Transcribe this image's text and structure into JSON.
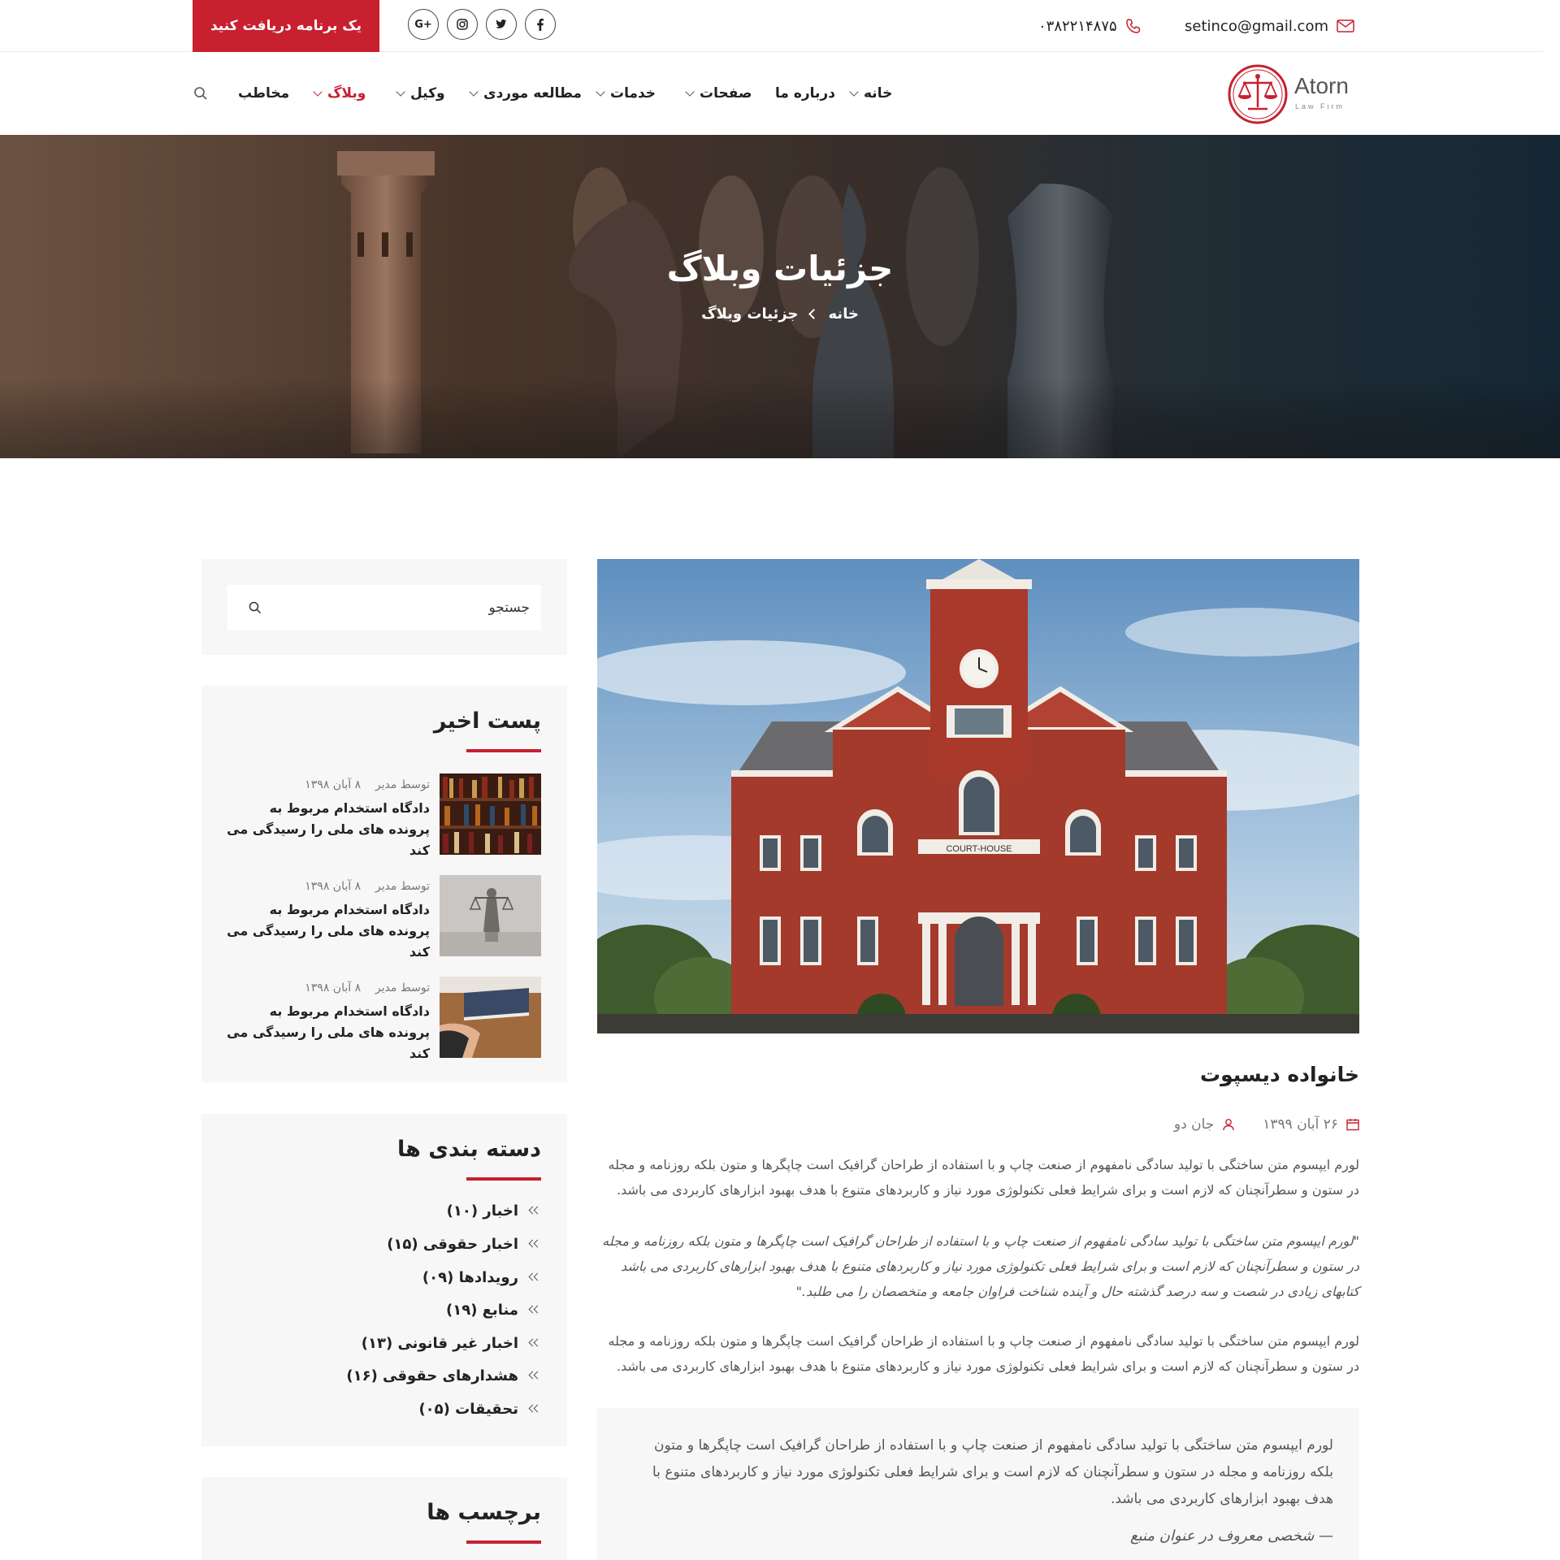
{
  "topbar": {
    "email": "setinco@gmail.com",
    "phone": "۰۳۸۲۲۱۴۸۷۵",
    "cta_label": "یک برنامه دریافت کنید",
    "social": [
      "facebook-icon",
      "twitter-icon",
      "instagram-icon",
      "google-plus-icon"
    ],
    "google_plus_label": "G+"
  },
  "logo": {
    "name": "Atorn",
    "sub": "Law Firm"
  },
  "nav": {
    "items": [
      {
        "label": "خانه",
        "dropdown": true
      },
      {
        "label": "درباره ما",
        "dropdown": false
      },
      {
        "label": "صفحات",
        "dropdown": true
      },
      {
        "label": "خدمات",
        "dropdown": true
      },
      {
        "label": "مطالعه موردی",
        "dropdown": true
      },
      {
        "label": "وکیل",
        "dropdown": true
      },
      {
        "label": "وبلاگ",
        "dropdown": true,
        "active": true
      },
      {
        "label": "مخاطب",
        "dropdown": false
      }
    ]
  },
  "hero": {
    "title": "جزئیات وبلاگ",
    "crumb_home": "خانه",
    "crumb_current": "جزئیات وبلاگ"
  },
  "sidebar": {
    "search_placeholder": "جستجو",
    "recent_title": "پست اخیر",
    "recent_posts": [
      {
        "author": "توسط مدیر",
        "date": "۸ آبان ۱۳۹۸",
        "title": "دادگاه استخدام مربوط به پرونده های ملی را رسیدگی می کند"
      },
      {
        "author": "توسط مدیر",
        "date": "۸ آبان ۱۳۹۸",
        "title": "دادگاه استخدام مربوط به پرونده های ملی را رسیدگی می کند"
      },
      {
        "author": "توسط مدیر",
        "date": "۸ آبان ۱۳۹۸",
        "title": "دادگاه استخدام مربوط به پرونده های ملی را رسیدگی می کند"
      }
    ],
    "categories_title": "دسته بندی ها",
    "categories": [
      "اخبار (۱۰)",
      "اخبار حقوقی (۱۵)",
      "رویدادها (۰۹)",
      "منابع (۱۹)",
      "اخبار غیر قانونی (۱۳)",
      "هشدارهای حقوقی (۱۶)",
      "تحقیقات (۰۵)"
    ],
    "tags_title": "برچسب ها"
  },
  "post": {
    "image_caption": "COURT-HOUSE",
    "heading": "خانواده دیسپوت",
    "date": "۲۶ آبان ۱۳۹۹",
    "author": "جان دو",
    "p1": "لورم ایپسوم متن ساختگی با تولید سادگی نامفهوم از صنعت چاپ و با استفاده از طراحان گرافیک است چاپگرها و متون بلکه روزنامه و مجله در ستون و سطرآنچنان که لازم است و برای شرایط فعلی تکنولوژی مورد نیاز و کاربردهای متنوع با هدف بهبود ابزارهای کاربردی می باشد.",
    "p2": "\"لورم ایپسوم متن ساختگی با تولید سادگی نامفهوم از صنعت چاپ و با استفاده از طراحان گرافیک است چاپگرها و متون بلکه روزنامه و مجله در ستون و سطرآنچنان که لازم است و برای شرایط فعلی تکنولوژی مورد نیاز و کاربردهای متنوع با هدف بهبود ابزارهای کاربردی می باشد کتابهای زیادی در شصت و سه درصد گذشته حال و آینده شناخت فراوان جامعه و متخصصان را می طلبد.\"",
    "p3": "لورم ایپسوم متن ساختگی با تولید سادگی نامفهوم از صنعت چاپ و با استفاده از طراحان گرافیک است چاپگرها و متون بلکه روزنامه و مجله در ستون و سطرآنچنان که لازم است و برای شرایط فعلی تکنولوژی مورد نیاز و کاربردهای متنوع با هدف بهبود ابزارهای کاربردی می باشد.",
    "quote": "لورم ایپسوم متن ساختگی با تولید سادگی نامفهوم از صنعت چاپ و با استفاده از طراحان گرافیک است چاپگرها و متون بلکه روزنامه و مجله در ستون و سطرآنچنان که لازم است و برای شرایط فعلی تکنولوژی مورد نیاز و کاربردهای متنوع با هدف بهبود ابزارهای کاربردی می باشد.",
    "quote_source": "— شخصی معروف در عنوان منبع"
  },
  "colors": {
    "accent": "#c8202f",
    "text": "#222222",
    "muted": "#777777",
    "widget_bg": "#f7f7f7"
  }
}
